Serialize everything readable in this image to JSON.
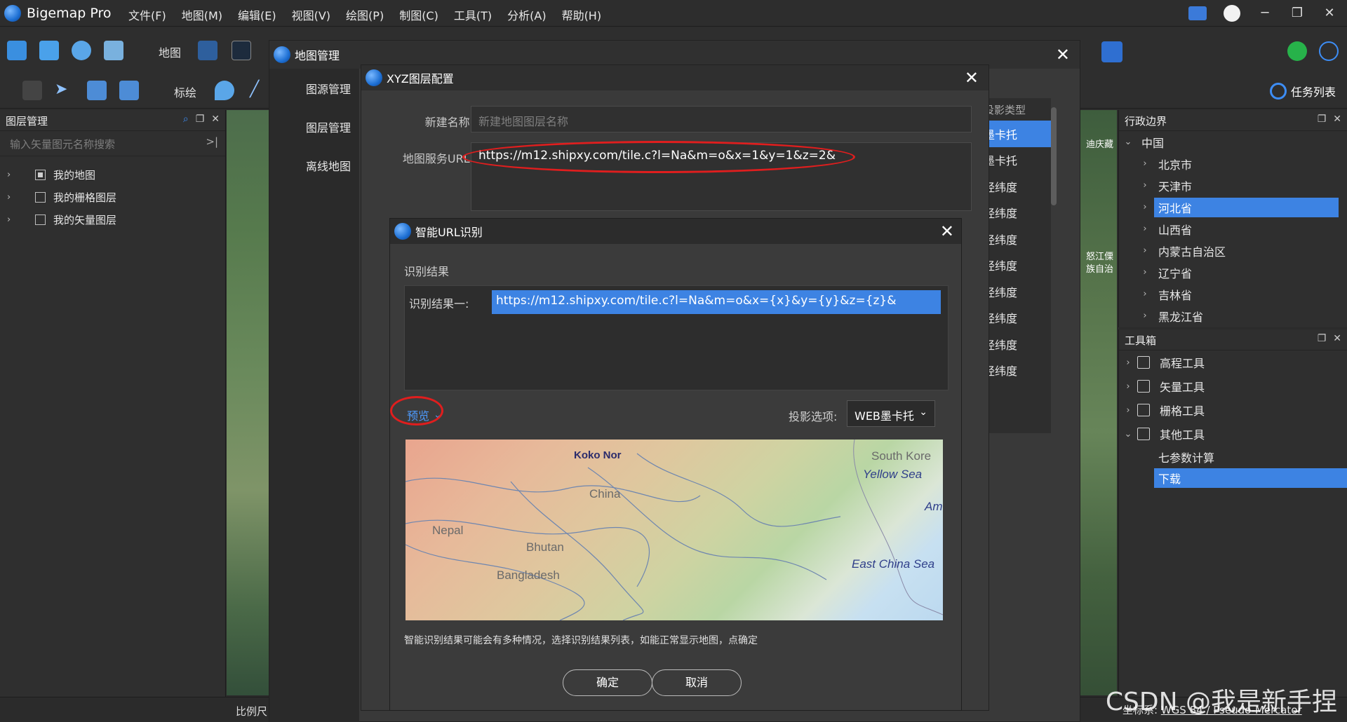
{
  "app": {
    "title": "Bigemap Pro",
    "menu": [
      "文件(F)",
      "地图(M)",
      "编辑(E)",
      "视图(V)",
      "绘图(P)",
      "制图(C)",
      "工具(T)",
      "分析(A)",
      "帮助(H)"
    ],
    "window_controls": [
      "─",
      "❐",
      "✕"
    ]
  },
  "toolbar": {
    "map_label": "地图",
    "draw_label": "标绘",
    "task_list_label": "任务列表"
  },
  "layer_panel": {
    "title": "图层管理",
    "search_placeholder": "输入矢量图元名称搜索",
    "items": [
      "我的地图",
      "我的栅格图层",
      "我的矢量图层"
    ]
  },
  "admin_panel": {
    "title": "行政边界",
    "root": "中国",
    "items": [
      "北京市",
      "天津市",
      "河北省",
      "山西省",
      "内蒙古自治区",
      "辽宁省",
      "吉林省",
      "黑龙江省"
    ],
    "selected": "河北省"
  },
  "toolbox_panel": {
    "title": "工具箱",
    "items": [
      "高程工具",
      "矢量工具",
      "栅格工具",
      "其他工具"
    ],
    "sub_items": [
      "七参数计算",
      "下载"
    ],
    "selected_sub": "下载"
  },
  "map_manager": {
    "title": "地图管理",
    "nav": [
      "图源管理",
      "图层管理",
      "离线地图"
    ],
    "list_header": "投影类型",
    "list": [
      "墨卡托",
      "墨卡托",
      "经纬度",
      "经纬度",
      "经纬度",
      "经纬度",
      "经纬度",
      "经纬度",
      "经纬度",
      "经纬度"
    ]
  },
  "xyz_dialog": {
    "title": "XYZ图层配置",
    "name_label": "新建名称:",
    "name_placeholder": "新建地图图层名称",
    "url_label": "地图服务URL:",
    "url_value": "https://m12.shipxy.com/tile.c?l=Na&m=o&x=1&y=1&z=2&"
  },
  "smart_url": {
    "title": "智能URL识别",
    "result_title": "识别结果",
    "result_label": "识别结果一:",
    "result_url": "https://m12.shipxy.com/tile.c?l=Na&m=o&x={x}&y={y}&z={z}&",
    "preview_label": "预览",
    "projection_label": "投影选项:",
    "projection_value": "WEB墨卡托",
    "hint": "智能识别结果可能会有多种情况，选择识别结果列表，如能正常显示地图，点确定",
    "ok_label": "确定",
    "cancel_label": "取消",
    "map_labels": {
      "koko": "Koko Nor",
      "china": "China",
      "nepal": "Nepal",
      "bhutan": "Bhutan",
      "bangladesh": "Bangladesh",
      "south_korea": "South Kore",
      "yellow_sea": "Yellow Sea",
      "east_china_sea": "East China Sea",
      "am": "Am"
    }
  },
  "map_view": {
    "scale_label": "比例尺",
    "left_labels": [
      "迪庆藏",
      "怒江傈",
      "族自治"
    ],
    "coord_prefix": "坐标系:",
    "coord_system": "WGS 84 / Pseudo-Mercator"
  },
  "watermark": "CSDN @我是新手捏",
  "colors": {
    "accent": "#3d83e3",
    "highlight_red": "#e01e1e",
    "link_blue": "#4d9bff"
  }
}
